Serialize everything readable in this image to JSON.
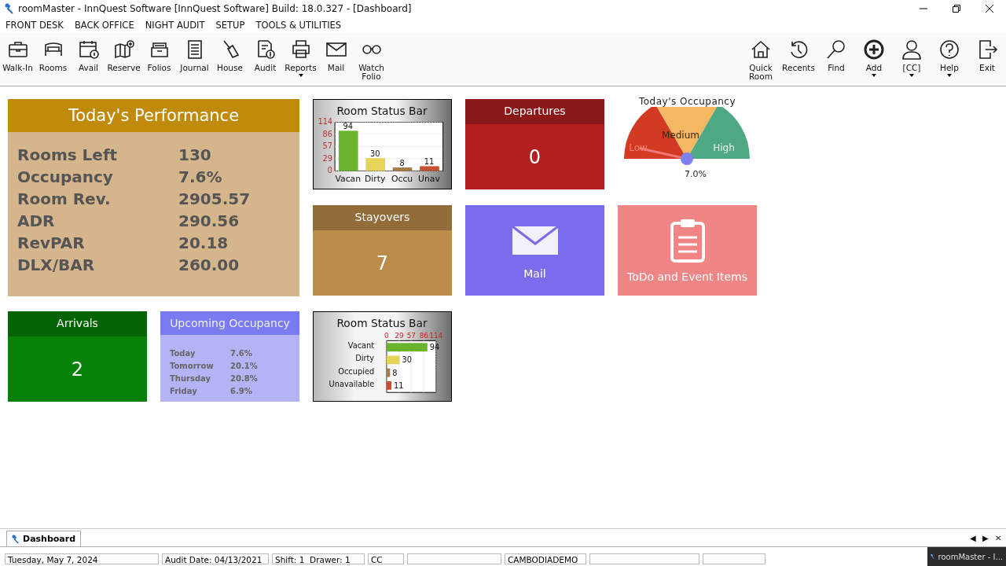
{
  "window": {
    "title": "roomMaster - InnQuest Software [InnQuest Software]  Build: 18.0.327 - [Dashboard]"
  },
  "menu": [
    "FRONT DESK",
    "BACK OFFICE",
    "NIGHT AUDIT",
    "SETUP",
    "TOOLS & UTILITIES"
  ],
  "toolbar_left": [
    {
      "label": "Walk-In",
      "dropdown": false
    },
    {
      "label": "Rooms",
      "dropdown": false
    },
    {
      "label": "Avail",
      "dropdown": false
    },
    {
      "label": "Reserve",
      "dropdown": false
    },
    {
      "label": "Folios",
      "dropdown": false
    },
    {
      "label": "Journal",
      "dropdown": false
    },
    {
      "label": "House",
      "dropdown": false
    },
    {
      "label": "Audit",
      "dropdown": false
    },
    {
      "label": "Reports",
      "dropdown": true
    },
    {
      "label": "Mail",
      "dropdown": false
    },
    {
      "label": "Watch Folio",
      "dropdown": false
    }
  ],
  "toolbar_right": [
    {
      "label": "Quick Room",
      "dropdown": false
    },
    {
      "label": "Recents",
      "dropdown": false
    },
    {
      "label": "Find",
      "dropdown": false
    },
    {
      "label": "Add",
      "dropdown": true
    },
    {
      "label": "[CC]",
      "dropdown": true
    },
    {
      "label": "Help",
      "dropdown": true
    },
    {
      "label": "Exit",
      "dropdown": false
    }
  ],
  "tiles": [
    {
      "kind": "performance",
      "title": "Today's Performance",
      "rows": [
        {
          "label": "Rooms Left",
          "value": "130"
        },
        {
          "label": "Occupancy",
          "value": "7.6%"
        },
        {
          "label": "Room Rev.",
          "value": "2905.57"
        },
        {
          "label": "ADR",
          "value": "290.56"
        },
        {
          "label": "RevPAR",
          "value": "20.18"
        },
        {
          "label": "DLX/BAR",
          "value": "260.00"
        }
      ]
    },
    {
      "kind": "chart",
      "title": "Room Status Bar",
      "chart_data": {
        "type": "bar",
        "orientation": "vertical",
        "categories": [
          "Vacan",
          "Dirty",
          "Occu",
          "Unav"
        ],
        "series": [
          {
            "color": "#6ab42d",
            "values": [
              94,
              null,
              null,
              null
            ]
          },
          {
            "color": "#e6d35a",
            "values": [
              null,
              30,
              null,
              null
            ]
          },
          {
            "color": "#a47c45",
            "values": [
              null,
              null,
              8,
              null
            ]
          },
          {
            "color": "#c4512f",
            "values": [
              null,
              null,
              null,
              11
            ]
          }
        ],
        "ylim": [
          0,
          114
        ],
        "yticks": [
          0,
          29,
          57,
          86,
          114
        ],
        "grid": true,
        "data_labels": true
      }
    },
    {
      "kind": "count",
      "title": "Departures",
      "value": "0",
      "color": "#b31f1f"
    },
    {
      "kind": "gauge",
      "title": "Today's Occupancy",
      "segments": [
        "Low",
        "Medium",
        "High"
      ],
      "reading": "7.0%"
    },
    {
      "kind": "count",
      "title": "Stayovers",
      "value": "7",
      "color": "#bc8c4a"
    },
    {
      "kind": "mail",
      "title": "Mail",
      "color": "#7b6cec"
    },
    {
      "kind": "todo",
      "title": "ToDo and Event Items",
      "color": "#f08585"
    },
    {
      "kind": "count",
      "title": "Arrivals",
      "value": "2",
      "color": "#078207"
    },
    {
      "kind": "upcoming",
      "title": "Upcoming Occupancy",
      "rows": [
        {
          "label": "Today",
          "value": "7.6%"
        },
        {
          "label": "Tomorrow",
          "value": "20.1%"
        },
        {
          "label": "Thursday",
          "value": "20.8%"
        },
        {
          "label": "Friday",
          "value": "6.9%"
        }
      ]
    },
    {
      "kind": "chart",
      "title": "Room Status Bar",
      "chart_data": {
        "type": "bar",
        "orientation": "horizontal",
        "categories": [
          "Vacant",
          "Dirty",
          "Occupied",
          "Unavailable"
        ],
        "series": [
          {
            "color": "#6ab42d",
            "values": [
              94,
              null,
              null,
              null
            ]
          },
          {
            "color": "#e6d35a",
            "values": [
              null,
              30,
              null,
              null
            ]
          },
          {
            "color": "#a47c45",
            "values": [
              null,
              null,
              8,
              null
            ]
          },
          {
            "color": "#c4512f",
            "values": [
              null,
              null,
              null,
              11
            ]
          }
        ],
        "xlim": [
          0,
          114
        ],
        "xticks": [
          0,
          29,
          57,
          86,
          114
        ],
        "grid": true,
        "data_labels": true
      }
    }
  ],
  "doc_tabs": [
    {
      "label": "Dashboard",
      "selected": true
    }
  ],
  "tab_nav": [
    "◀",
    "▶",
    "✕"
  ],
  "status_bar": [
    "Tuesday,  May 7, 2024",
    "Audit Date: 04/13/2021",
    "Shift: 1",
    "Drawer: 1",
    "CC",
    "CAMBODIADEMO"
  ],
  "taskbar_item": "roomMaster - I..."
}
